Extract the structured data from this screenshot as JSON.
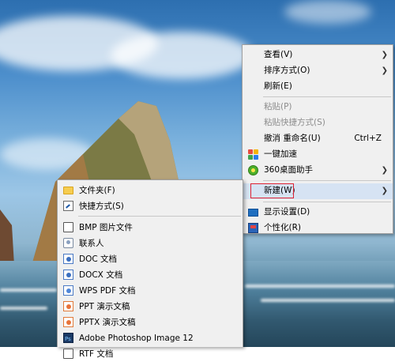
{
  "context_menu": {
    "items": [
      {
        "label": "查看(V)",
        "submenu": true
      },
      {
        "label": "排序方式(O)",
        "submenu": true
      },
      {
        "label": "刷新(E)"
      },
      {
        "label": "粘贴(P)",
        "disabled": true
      },
      {
        "label": "粘贴快捷方式(S)",
        "disabled": true
      },
      {
        "label": "撤消 重命名(U)",
        "shortcut": "Ctrl+Z"
      },
      {
        "label": "一键加速",
        "icon": "speedup-icon"
      },
      {
        "label": "360桌面助手",
        "icon": "desktop-helper-icon",
        "submenu": true
      },
      {
        "label": "新建(W)",
        "submenu": true,
        "selected": true
      },
      {
        "label": "显示设置(D)",
        "icon": "display-settings-icon"
      },
      {
        "label": "个性化(R)",
        "icon": "personalize-icon"
      }
    ]
  },
  "new_submenu": {
    "items": [
      {
        "label": "文件夹(F)",
        "icon": "folder-icon"
      },
      {
        "label": "快捷方式(S)",
        "icon": "shortcut-icon"
      },
      {
        "label": "BMP 图片文件",
        "icon": "bmp-file-icon"
      },
      {
        "label": "联系人",
        "icon": "contact-icon"
      },
      {
        "label": "DOC 文档",
        "icon": "doc-file-icon"
      },
      {
        "label": "DOCX 文档",
        "icon": "docx-file-icon"
      },
      {
        "label": "WPS PDF 文档",
        "icon": "pdf-file-icon"
      },
      {
        "label": "PPT 演示文稿",
        "icon": "ppt-file-icon"
      },
      {
        "label": "PPTX 演示文稿",
        "icon": "pptx-file-icon"
      },
      {
        "label": "Adobe Photoshop Image 12",
        "icon": "photoshop-icon"
      },
      {
        "label": "RTF 文档",
        "icon": "rtf-file-icon"
      }
    ]
  },
  "colors": {
    "menu_bg": "#f0f0f0",
    "selection_outline": "#dd2233",
    "disabled_text": "#8c8c8c"
  }
}
